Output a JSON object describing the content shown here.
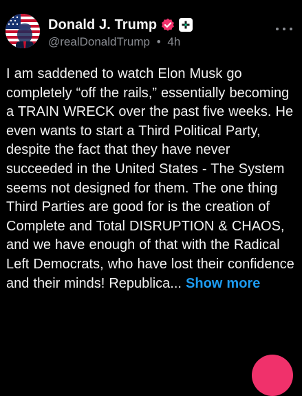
{
  "post": {
    "author": {
      "display_name": "Donald J. Trump",
      "handle": "@realDonaldTrump",
      "separator": "•",
      "time": "4h",
      "avatar": "american-flag-portrait-avatar",
      "badges": [
        "verified-badge-icon",
        "plus-badge-icon"
      ]
    },
    "body_text": "I am saddened to watch Elon Musk go completely “off the rails,” essentially becoming a TRAIN WRECK over the past five weeks. He even wants to start a Third Political Party, despite the fact that they have never succeeded in the United States - The System seems not designed for them. The one thing Third Parties are good for is the creation of Complete and Total DISRUPTION & CHAOS, and we have enough of that with the Radical Left Democrats, who have lost their confidence and their minds! Republica... ",
    "show_more_label": "Show more",
    "more_icon": "ellipsis-icon"
  },
  "colors": {
    "background": "#000000",
    "text": "#f2f2f2",
    "muted": "#8a8d93",
    "link": "#1d9bf0",
    "verified": "#f0316b",
    "fab": "#f0316b"
  }
}
